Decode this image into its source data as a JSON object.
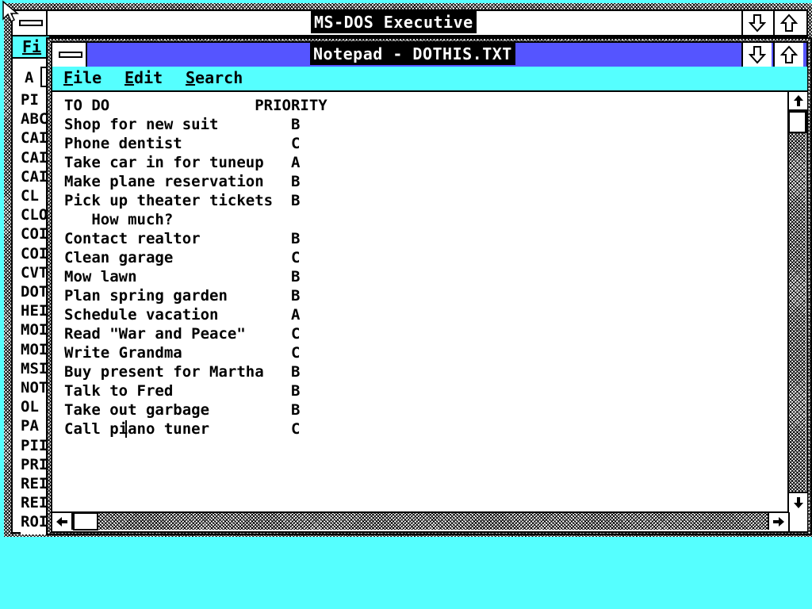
{
  "exec_window": {
    "title": "MS-DOS Executive",
    "menu_visible": "Fi",
    "drive_letter": "A",
    "file_list": [
      "PI",
      "ABC",
      "CAI",
      "CAI",
      "CAI",
      "CL",
      "CLO",
      "COI",
      "COI",
      "CVT",
      "DOT",
      "HEI",
      "MOI",
      "MOI",
      "MSI",
      "NOT",
      "OL",
      "PA",
      "PII",
      "PRI",
      "REI",
      "REI",
      "ROI"
    ]
  },
  "notepad": {
    "title": "Notepad - DOTHIS.TXT",
    "menu": [
      {
        "underline": "F",
        "rest": "ile"
      },
      {
        "underline": "E",
        "rest": "dit"
      },
      {
        "underline": "S",
        "rest": "earch"
      }
    ],
    "lines": [
      "TO DO                PRIORITY",
      "Shop for new suit        B",
      "Phone dentist            C",
      "Take car in for tuneup   A",
      "Make plane reservation   B",
      "Pick up theater tickets  B",
      "   How much?",
      "Contact realtor          B",
      "Clean garage             C",
      "Mow lawn                 B",
      "Plan spring garden       B",
      "Schedule vacation        A",
      "Read \"War and Peace\"     C",
      "Write Grandma            C",
      "Buy present for Martha   B",
      "Talk to Fred             B",
      "Take out garbage         B",
      "Call piano tuner         C"
    ]
  },
  "icons": [
    "system-menu-icon",
    "minimize-arrow-icon",
    "maximize-arrow-icon",
    "scroll-up-arrow-icon",
    "scroll-down-arrow-icon",
    "scroll-left-arrow-icon",
    "scroll-right-arrow-icon",
    "mouse-pointer-icon"
  ],
  "colors": {
    "desktop": "#55ffff",
    "active_title": "#5555ff",
    "menu_bar": "#55ffff",
    "window": "#ffffff",
    "text": "#000000"
  }
}
